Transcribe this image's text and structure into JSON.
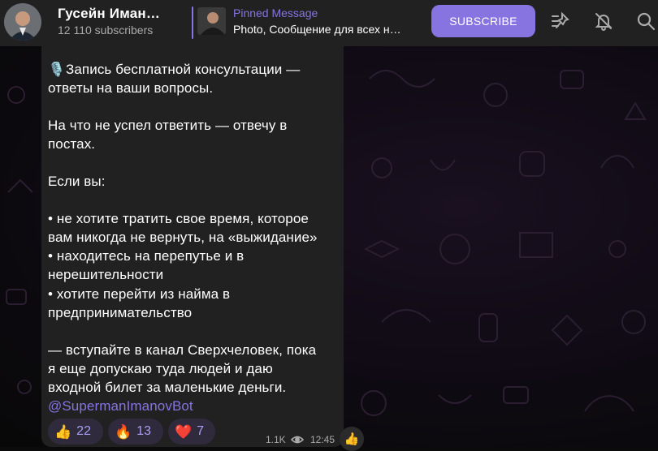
{
  "header": {
    "channel_name": "Гусейн Иман…",
    "subscribers": "12 110 subscribers",
    "pinned_label": "Pinned Message",
    "pinned_preview": "Photo, Сообщение для всех н…",
    "subscribe_label": "SUBSCRIBE",
    "icons": [
      "pinned-list-icon",
      "mute-bell-icon",
      "search-icon"
    ]
  },
  "message": {
    "lines": [
      "Запись бесплатной консультации —",
      "ответы на ваши вопросы.",
      "",
      "На что не успел ответить — отвечу в",
      "постах.",
      "",
      "Если вы:",
      "",
      "• не хотите тратить свое время, которое",
      "вам никогда не вернуть, на «выжидание»",
      "• находитесь на перепутье и в",
      "нерешительности",
      "• хотите перейти из найма в",
      "предпринимательство",
      "",
      "— вступайте в канал Сверхчеловек, пока",
      "я еще допускаю туда людей и даю",
      "входной билет за маленькие деньги."
    ],
    "link": "@SupermanImanovBot",
    "reactions": [
      {
        "emoji": "👍",
        "count": "22"
      },
      {
        "emoji": "🔥",
        "count": "13"
      },
      {
        "emoji": "❤️",
        "count": "7"
      }
    ],
    "views": "1.1K",
    "time": "12:45",
    "side_reaction": "👍"
  },
  "colors": {
    "accent": "#8774e1",
    "header_bg": "#212121",
    "bubble_bg": "#212121"
  }
}
